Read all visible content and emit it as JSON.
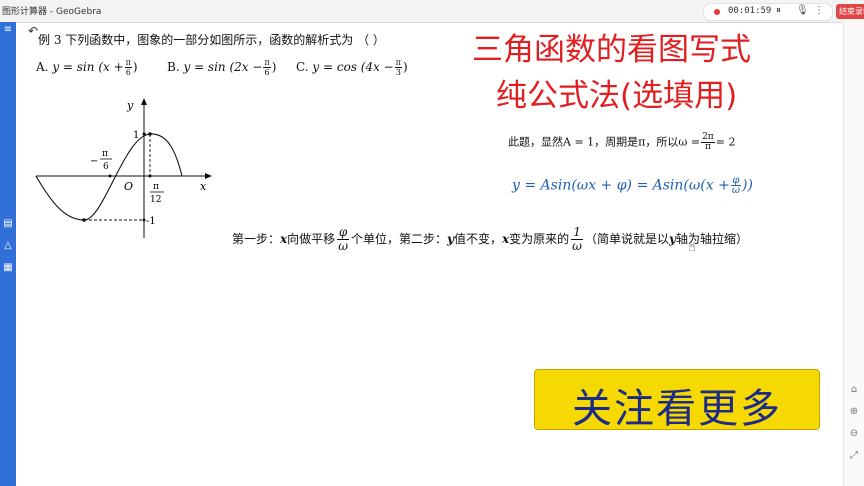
{
  "window": {
    "title": "图形计算器 - GeoGebra"
  },
  "recorder": {
    "time": "00:01:59",
    "end_label": "结束录制"
  },
  "problem": {
    "prefix": "例 3",
    "text": "下列函数中，图象的一部分如图所示，函数的解析式为 （    ）",
    "options": [
      {
        "label": "A.",
        "func": "y = sin (x +",
        "num": "π",
        "den": "6",
        "close": ")"
      },
      {
        "label": "B.",
        "func": "y = sin (2x −",
        "num": "π",
        "den": "6",
        "close": ")"
      },
      {
        "label": "C.",
        "func": "y = cos (4x −",
        "num": "π",
        "den": "3",
        "close": ")"
      }
    ]
  },
  "graph": {
    "labels": {
      "y_axis": "y",
      "x_axis": "x",
      "origin": "O",
      "one": "1",
      "neg_one": "-1",
      "left_num": "π",
      "left_den": "6",
      "left_sign": "−",
      "right_num": "π",
      "right_den": "12"
    }
  },
  "heading": {
    "line1": "三角函数的看图写式",
    "line2": "纯公式法(选填用)"
  },
  "note": {
    "text": "此题，显然A = 1，周期是π，所以ω =",
    "num": "2π",
    "den": "π",
    "tail": "= 2"
  },
  "formula": {
    "left": "y = Asin(ωx + φ) = Asin(ω(x +",
    "num": "φ",
    "den": "ω",
    "right": "))"
  },
  "steps": {
    "s1": "第一步：",
    "x1": "x",
    "s2": "向做平移",
    "f1_num": "φ",
    "f1_den": "ω",
    "s3": "个单位，第二步：",
    "y1": "y",
    "s4": "值不变，",
    "x2": "x",
    "s5": "变为原来的",
    "f2_num": "1",
    "f2_den": "ω",
    "s6": "（简单说就是以",
    "y2": "y",
    "s7": "轴为轴拉缩）"
  },
  "banner": {
    "text": "关注看更多"
  },
  "colors": {
    "heading": "#e02020",
    "formula": "#1f5fb0",
    "banner_bg": "#f5d900",
    "banner_text": "#1c2a8a",
    "sidebar": "#2f6fd7"
  }
}
